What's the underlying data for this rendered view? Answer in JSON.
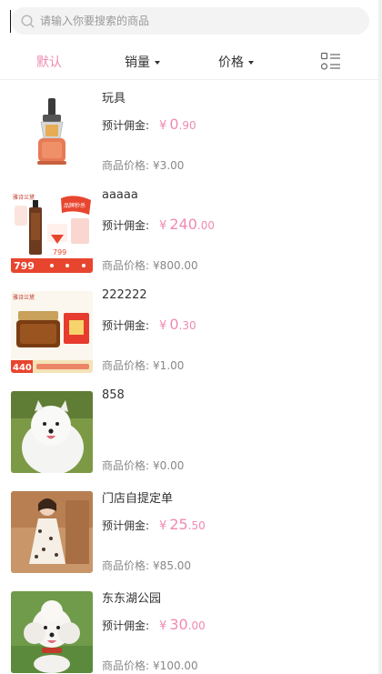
{
  "search": {
    "placeholder": "请输入你要搜索的商品"
  },
  "sort_tabs": [
    {
      "label": "默认",
      "active": true
    },
    {
      "label": "销量",
      "has_dropdown": true
    },
    {
      "label": "价格",
      "has_dropdown": true
    }
  ],
  "commission_label": "预计佣金:",
  "price_label": "商品价格:",
  "currency_symbol": "¥",
  "accent_color": "#f08ab2",
  "products": [
    {
      "title": "玩具",
      "commission_int": "0",
      "commission_dec": ".90",
      "price": "¥3.00",
      "image": "juicer"
    },
    {
      "title": "aaaaa",
      "commission_int": "240",
      "commission_dec": ".00",
      "price": "¥800.00",
      "image": "serum-ad"
    },
    {
      "title": "222222",
      "commission_int": "0",
      "commission_dec": ".30",
      "price": "¥1.00",
      "image": "cream-ad"
    },
    {
      "title": "858",
      "commission_int": null,
      "commission_dec": null,
      "price": "¥0.00",
      "image": "samoyed"
    },
    {
      "title": "门店自提定单",
      "commission_int": "25",
      "commission_dec": ".50",
      "price": "¥85.00",
      "image": "dress-model"
    },
    {
      "title": "东东湖公园",
      "commission_int": "30",
      "commission_dec": ".00",
      "price": "¥100.00",
      "image": "poodle"
    }
  ],
  "ad_labels": {
    "brand": "雅诗兰黛",
    "badge": "品牌秒杀",
    "serum_price_large": "799",
    "serum_price_small": "799",
    "cream_price": "440"
  }
}
